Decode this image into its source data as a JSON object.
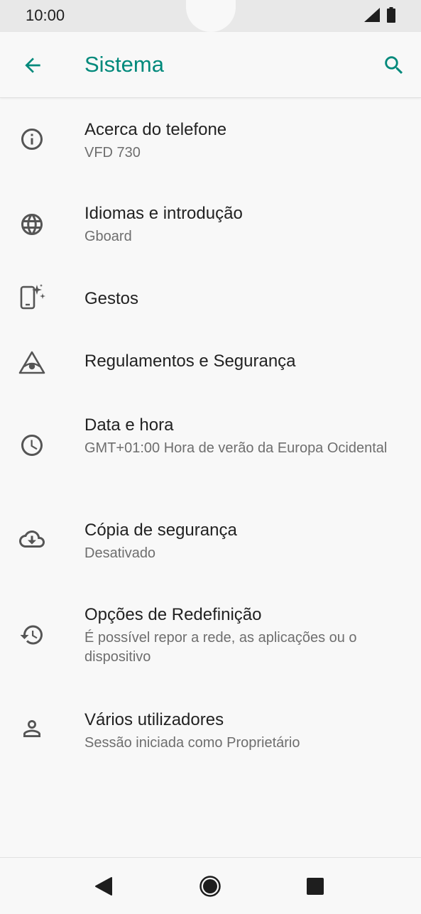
{
  "status_bar": {
    "time": "10:00",
    "icons": [
      "signal-icon",
      "battery-icon"
    ]
  },
  "app_bar": {
    "title": "Sistema",
    "back_icon": "arrow-back-icon",
    "search_icon": "search-icon"
  },
  "colors": {
    "accent": "#00897b",
    "background": "#f8f8f8",
    "text_primary": "#222222",
    "text_secondary": "#6e6e6e",
    "icon": "#555555"
  },
  "items": [
    {
      "icon": "info-icon",
      "title": "Acerca do telefone",
      "subtitle": "VFD 730"
    },
    {
      "icon": "globe-icon",
      "title": "Idiomas e introdução",
      "subtitle": "Gboard"
    },
    {
      "icon": "gestures-icon",
      "title": "Gestos",
      "subtitle": ""
    },
    {
      "icon": "regulatory-icon",
      "title": "Regulamentos e Segurança",
      "subtitle": ""
    },
    {
      "icon": "clock-icon",
      "title": "Data e hora",
      "subtitle": "GMT+01:00 Hora de verão da Europa Ocidental"
    },
    {
      "icon": "cloud-backup-icon",
      "title": "Cópia de segurança",
      "subtitle": "Desativado"
    },
    {
      "icon": "restore-icon",
      "title": "Opções de Redefinição",
      "subtitle": "É possível repor a rede, as aplicações ou o dispositivo"
    },
    {
      "icon": "person-icon",
      "title": "Vários utilizadores",
      "subtitle": "Sessão iniciada como Proprietário"
    }
  ],
  "nav_bar": {
    "buttons": [
      "nav-back-icon",
      "nav-home-icon",
      "nav-recents-icon"
    ]
  }
}
